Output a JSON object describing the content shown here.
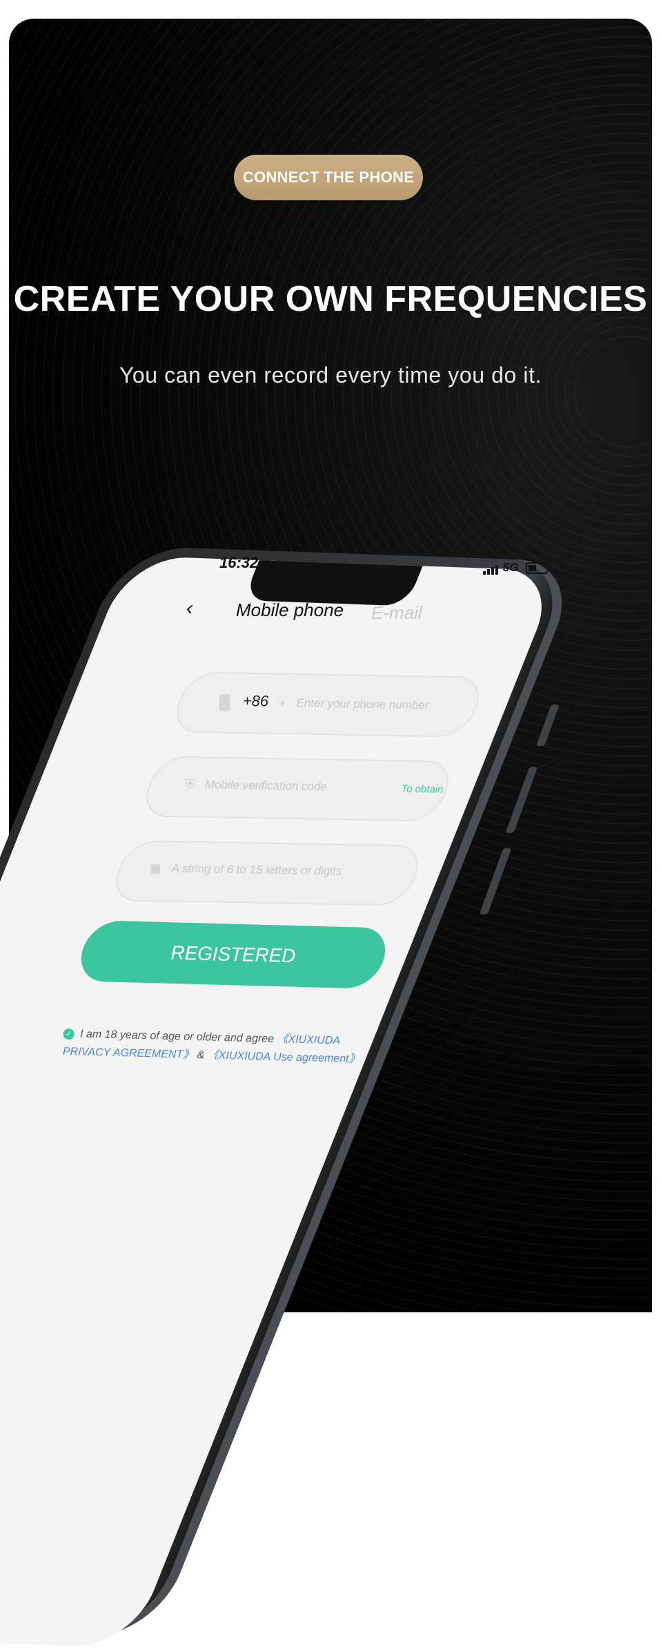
{
  "promo": {
    "badge_label": "CONNECT THE PHONE",
    "headline": "CREATE YOUR OWN FREQUENCIES",
    "subline": "You can even record every time you do it."
  },
  "phone": {
    "status": {
      "time": "16:32",
      "network": "5G"
    },
    "nav": {
      "back_icon": "chevron-left-icon",
      "tab_active": "Mobile phone",
      "tab_inactive": "E-mail"
    },
    "form": {
      "phone_prefix": "+86",
      "phone_placeholder": "Enter your phone number",
      "code_placeholder": "Mobile verification code",
      "code_action": "To obtain",
      "password_placeholder": "A string of 6 to 15 letters or digits",
      "submit_label": "REGISTERED"
    },
    "agreement": {
      "text": "I am 18 years of age or older and agree",
      "privacy_link": "《XIUXIUDA PRIVACY AGREEMENT》",
      "joiner": "&",
      "use_link": "《XIUXIUDA Use agreement》"
    }
  },
  "colors": {
    "accent": "#3cc5a0",
    "badge": "#c4a67b",
    "link": "#4a86d6",
    "background": "#000000"
  }
}
